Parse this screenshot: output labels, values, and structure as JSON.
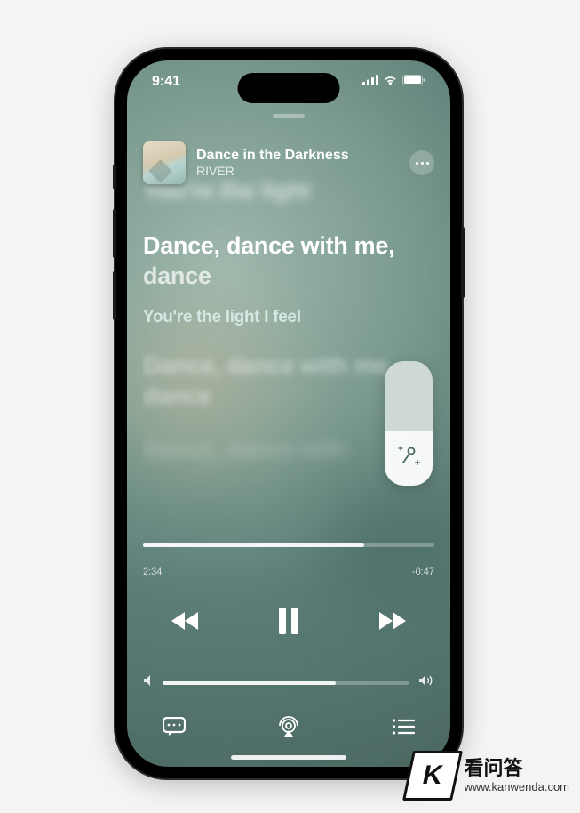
{
  "status": {
    "time": "9:41"
  },
  "track": {
    "title": "Dance in the Darkness",
    "artist": "RIVER"
  },
  "lyrics": {
    "prev": "You're the light",
    "current_sung": "Dance, dance with me, ",
    "current_unsung": "dance",
    "next": "You're the light I feel",
    "future1": "Dance, dance with me, dance",
    "future2": "Dance, dance with"
  },
  "playback": {
    "elapsed": "2:34",
    "remaining": "-0:47",
    "progress_pct": 76,
    "volume_pct": 70
  },
  "vocal_slider": {
    "level_pct": 44
  },
  "watermark": {
    "logo_letter": "K",
    "name_cn": "看问答",
    "url": "www.kanwenda.com"
  }
}
